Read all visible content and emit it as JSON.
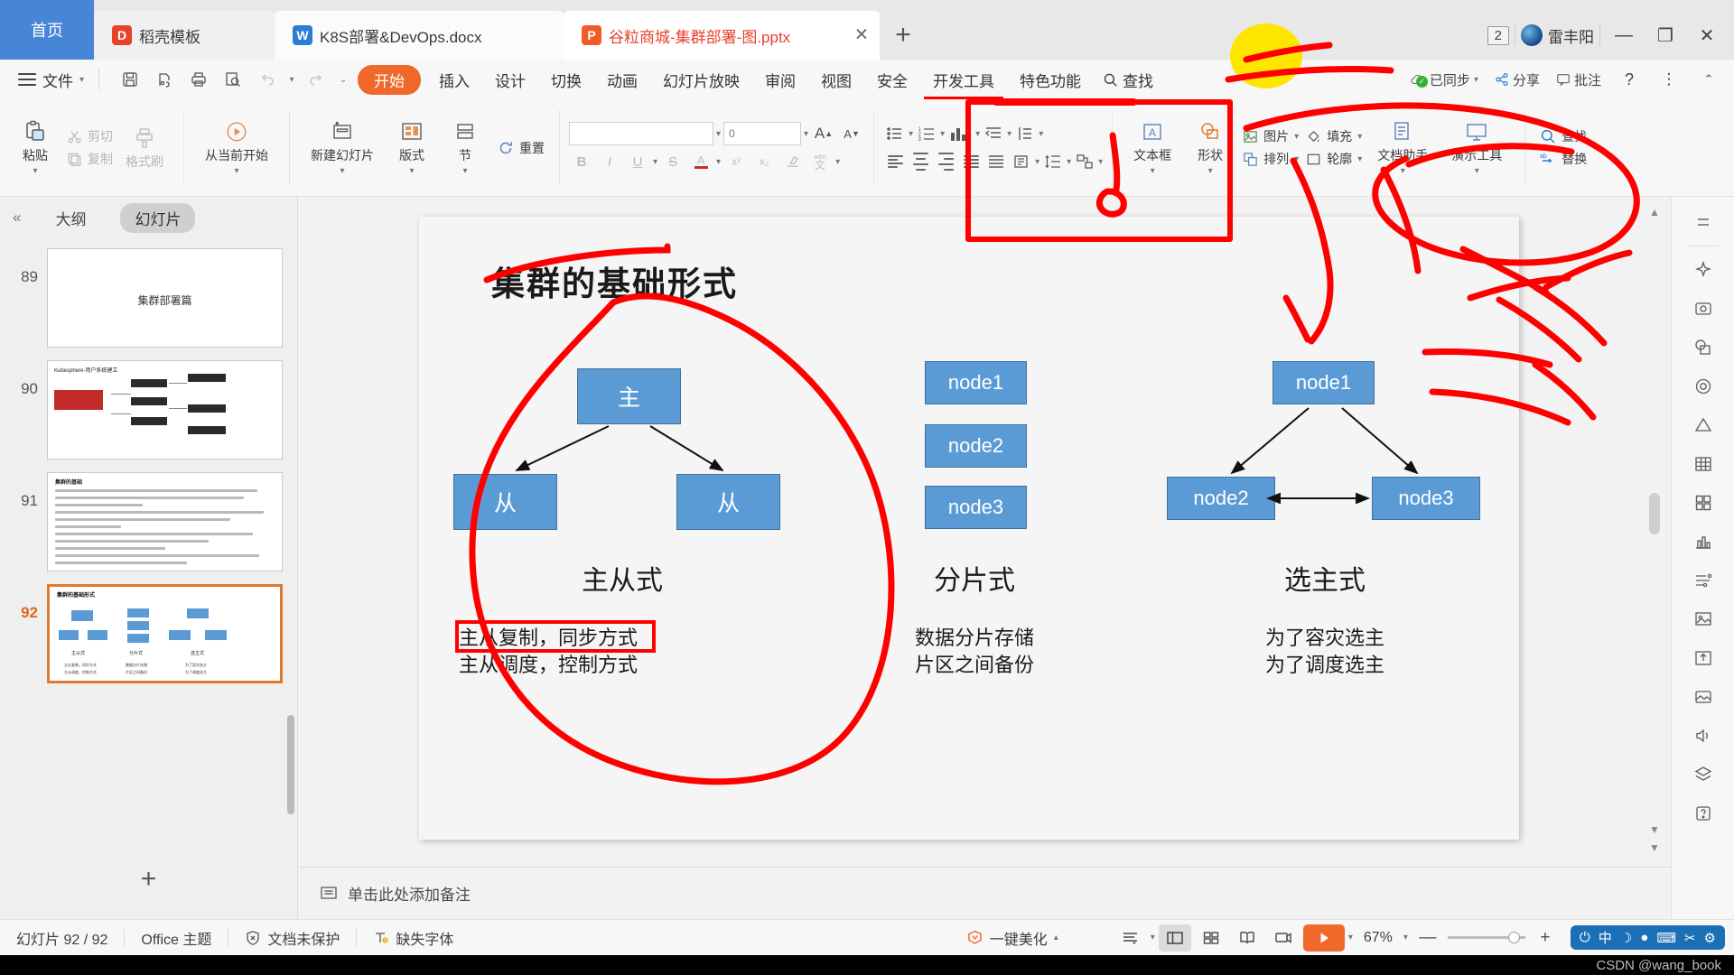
{
  "window": {
    "tabs": [
      {
        "label": "首页",
        "icon": "home-tab",
        "type": "home"
      },
      {
        "label": "稻壳模板",
        "icon": "docer-icon",
        "type": "plain"
      },
      {
        "label": "K8S部署&DevOps.docx",
        "icon": "word-icon",
        "type": "doc"
      },
      {
        "label": "谷粒商城-集群部署-图.pptx",
        "icon": "ppt-icon",
        "type": "selected"
      }
    ],
    "new_tab_label": "+",
    "window_count_badge": "2",
    "user_name": "雷丰阳",
    "minimize": "—",
    "restore": "❐",
    "close": "✕"
  },
  "menubar": {
    "file_label": "文件",
    "quick_access": [
      "save-icon",
      "save-as-icon",
      "print-icon",
      "print-preview-icon",
      "undo-icon",
      "redo-icon",
      "customize-icon"
    ],
    "active_tab": "开始",
    "tabs": [
      "插入",
      "设计",
      "切换",
      "动画",
      "幻灯片放映",
      "审阅",
      "视图",
      "安全",
      "开发工具",
      "特色功能"
    ],
    "search_label": "查找",
    "right_items": [
      {
        "label": "已同步",
        "icon": "cloud-sync-icon"
      },
      {
        "label": "分享",
        "icon": "share-icon"
      },
      {
        "label": "批注",
        "icon": "comment-icon"
      }
    ],
    "help_icon": "help-icon",
    "more_icon": "more-icon",
    "collapse_icon": "collapse-ribbon-icon"
  },
  "ribbon": {
    "clipboard": {
      "paste": "粘贴",
      "cut": "剪切",
      "copy": "复制",
      "format_painter": "格式刷"
    },
    "slideshow": {
      "from_current": "从当前开始"
    },
    "slides": {
      "new_slide": "新建幻灯片",
      "layout": "版式",
      "section": "节",
      "reset": "重置"
    },
    "font": {
      "font_name_value": "",
      "font_size_value": "0",
      "grow_font": "A",
      "shrink_font": "A",
      "bold": "B",
      "italic": "I",
      "underline": "U",
      "strikethrough": "S",
      "font_color": "A",
      "superscript": "x²",
      "subscript": "x₂",
      "clear_format": "clear-format-icon",
      "pinyin": "文"
    },
    "paragraph": {
      "bullets": "bullet-list-icon",
      "numbering": "numbered-list-icon",
      "chart": "smartart-icon",
      "line_spacing": "line-spacing-icon",
      "columns": "columns-icon",
      "align_left": "align-left-icon",
      "align_center": "align-center-icon",
      "align_right": "align-right-icon",
      "justify": "justify-icon",
      "distribute": "distribute-icon",
      "text_direction": "text-direction-icon",
      "align_text": "align-text-icon",
      "convert_smartart": "convert-smartart-icon"
    },
    "drawing": {
      "text_box": "文本框",
      "shape": "形状",
      "picture": "图片",
      "fill": "填充",
      "arrange": "排列",
      "outline": "轮廓",
      "doc_assistant": "文档助手",
      "present_tools": "演示工具"
    },
    "editing": {
      "find": "查找",
      "replace": "替换"
    }
  },
  "left_panel": {
    "collapse_icon": "collapse-panel-icon",
    "tab_outline": "大纲",
    "tab_slides": "幻灯片",
    "active_tab": "幻灯片",
    "add_slide_label": "+",
    "slides": [
      {
        "number": "89",
        "caption": "集群部署篇",
        "kind": "title"
      },
      {
        "number": "90",
        "caption": "Kubesphere-用户系统建立",
        "kind": "diagram"
      },
      {
        "number": "91",
        "caption": "集群的基础",
        "kind": "text"
      },
      {
        "number": "92",
        "caption": "集群的基础形式",
        "kind": "nodes",
        "selected": true
      }
    ]
  },
  "slide": {
    "title": "集群的基础形式",
    "columns": [
      {
        "name": "master-slave",
        "title": "主从式",
        "subtitle_lines": [
          "主从复制，同步方式",
          "主从调度，控制方式"
        ],
        "highlighted_line_index": 0,
        "nodes": [
          {
            "label": "主",
            "role": "master"
          },
          {
            "label": "从",
            "role": "slave"
          },
          {
            "label": "从",
            "role": "slave"
          }
        ]
      },
      {
        "name": "sharded",
        "title": "分片式",
        "subtitle_lines": [
          "数据分片存储",
          "片区之间备份"
        ],
        "nodes": [
          {
            "label": "node1"
          },
          {
            "label": "node2"
          },
          {
            "label": "node3"
          }
        ]
      },
      {
        "name": "elected-leader",
        "title": "选主式",
        "subtitle_lines": [
          "为了容灾选主",
          "为了调度选主"
        ],
        "nodes": [
          {
            "label": "node1"
          },
          {
            "label": "node2"
          },
          {
            "label": "node3"
          }
        ]
      }
    ],
    "node_fill_color": "#5b9bd5",
    "annotation_color": "#ff0000",
    "highlight_color": "#ffe600"
  },
  "notes": {
    "placeholder": "单击此处添加备注",
    "icon": "notes-icon"
  },
  "right_rail": {
    "items": [
      "sparkle-icon",
      "screenshot-icon",
      "shape-tool-icon",
      "target-icon",
      "triangle-icon",
      "table-icon",
      "grid-icon",
      "chart-icon",
      "flow-icon",
      "image-frame-icon",
      "export-icon",
      "picture-icon",
      "audio-icon",
      "layers-icon"
    ]
  },
  "status_bar": {
    "slide_counter": "幻灯片 92 / 92",
    "theme": "Office 主题",
    "protection": "文档未保护",
    "missing_font": "缺失字体",
    "beautify": "一键美化",
    "view_buttons": [
      "reading-layout-icon",
      "normal-view-icon",
      "slide-sorter-icon",
      "reading-view-icon",
      "presenter-view-icon"
    ],
    "play_label": "play-icon",
    "zoom_level": "67%",
    "zoom_out": "—",
    "zoom_in": "+",
    "ime": {
      "power": "⏻",
      "lang": "中",
      "moon": "☽",
      "dot": "●",
      "keyboard": "⌨",
      "tool": "✂",
      "gear": "⚙"
    }
  },
  "watermark": "CSDN @wang_book"
}
